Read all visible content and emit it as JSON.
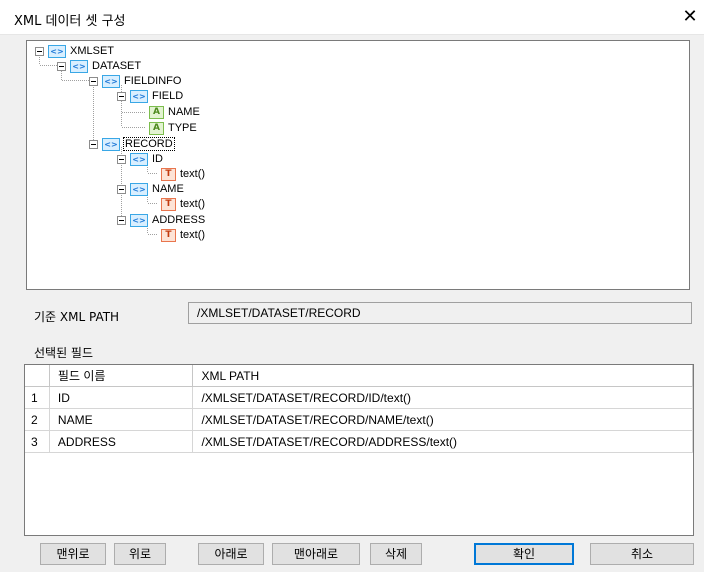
{
  "window": {
    "title": "XML 데이터 셋 구성",
    "close_glyph": "✕"
  },
  "tree": {
    "nodes": [
      {
        "label": "XMLSET",
        "type": "element",
        "expander": true,
        "icon_text": "<>"
      },
      {
        "label": "DATASET",
        "type": "element",
        "expander": true,
        "icon_text": "<>"
      },
      {
        "label": "FIELDINFO",
        "type": "element",
        "expander": true,
        "icon_text": "<>"
      },
      {
        "label": "FIELD",
        "type": "element",
        "expander": true,
        "icon_text": "<>"
      },
      {
        "label": "NAME",
        "type": "attribute",
        "expander": false,
        "icon_text": "A"
      },
      {
        "label": "TYPE",
        "type": "attribute",
        "expander": false,
        "icon_text": "A"
      },
      {
        "label": "RECORD",
        "type": "element",
        "expander": true,
        "icon_text": "<>",
        "selected": true
      },
      {
        "label": "ID",
        "type": "element",
        "expander": true,
        "icon_text": "<>"
      },
      {
        "label": "text()",
        "type": "text",
        "expander": false,
        "icon_text": "T"
      },
      {
        "label": "NAME",
        "type": "element",
        "expander": true,
        "icon_text": "<>"
      },
      {
        "label": "text()",
        "type": "text",
        "expander": false,
        "icon_text": "T"
      },
      {
        "label": "ADDRESS",
        "type": "element",
        "expander": true,
        "icon_text": "<>"
      },
      {
        "label": "text()",
        "type": "text",
        "expander": false,
        "icon_text": "T"
      }
    ]
  },
  "base_path": {
    "label": "기준 XML PATH",
    "value": "/XMLSET/DATASET/RECORD"
  },
  "selected_fields": {
    "label": "선택된 필드",
    "columns": [
      "",
      "필드 이름",
      "XML PATH"
    ],
    "rows": [
      {
        "num": "1",
        "name": "ID",
        "path": "/XMLSET/DATASET/RECORD/ID/text()"
      },
      {
        "num": "2",
        "name": "NAME",
        "path": "/XMLSET/DATASET/RECORD/NAME/text()"
      },
      {
        "num": "3",
        "name": "ADDRESS",
        "path": "/XMLSET/DATASET/RECORD/ADDRESS/text()"
      }
    ]
  },
  "buttons": {
    "top": "맨위로",
    "up": "위로",
    "down": "아래로",
    "bottom": "맨아래로",
    "delete": "삭제",
    "ok": "확인",
    "cancel": "취소"
  },
  "colors": {
    "element_icon": "#39a7e6",
    "attribute_icon": "#7cbd4d",
    "text_icon": "#e9754d",
    "default_button_border": "#0078d7"
  }
}
